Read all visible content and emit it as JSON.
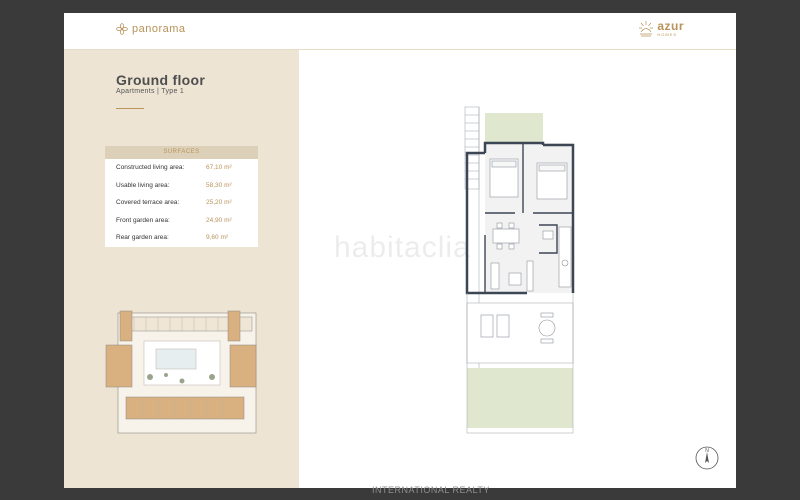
{
  "header": {
    "brand": "panorama",
    "partner_logo": "azur",
    "partner_logo_sub": "HOMES"
  },
  "panel": {
    "title": "Ground floor",
    "subtitle": "Apartments | Type 1"
  },
  "surfaces": {
    "heading": "SURFACES",
    "rows": [
      {
        "label": "Constructed living area:",
        "value": "67,10 m²"
      },
      {
        "label": "Usable living area:",
        "value": "58,30 m²"
      },
      {
        "label": "Covered terrace area:",
        "value": "25,20 m²"
      },
      {
        "label": "Front garden area:",
        "value": "24,90 m²"
      },
      {
        "label": "Rear garden area:",
        "value": "9,60 m²"
      }
    ]
  },
  "overlay": {
    "watermark": "habitaclia",
    "footer": "INTERNATIONAL REALTY"
  },
  "compass": {
    "north_label": "N"
  },
  "icons": [
    "panorama-flower-icon",
    "azur-sun-icon",
    "north-arrow-icon"
  ],
  "colors": {
    "accent": "#b8935a",
    "panel": "#ede4d4",
    "garden": "#dfe8cf",
    "wall": "#3d4654"
  }
}
